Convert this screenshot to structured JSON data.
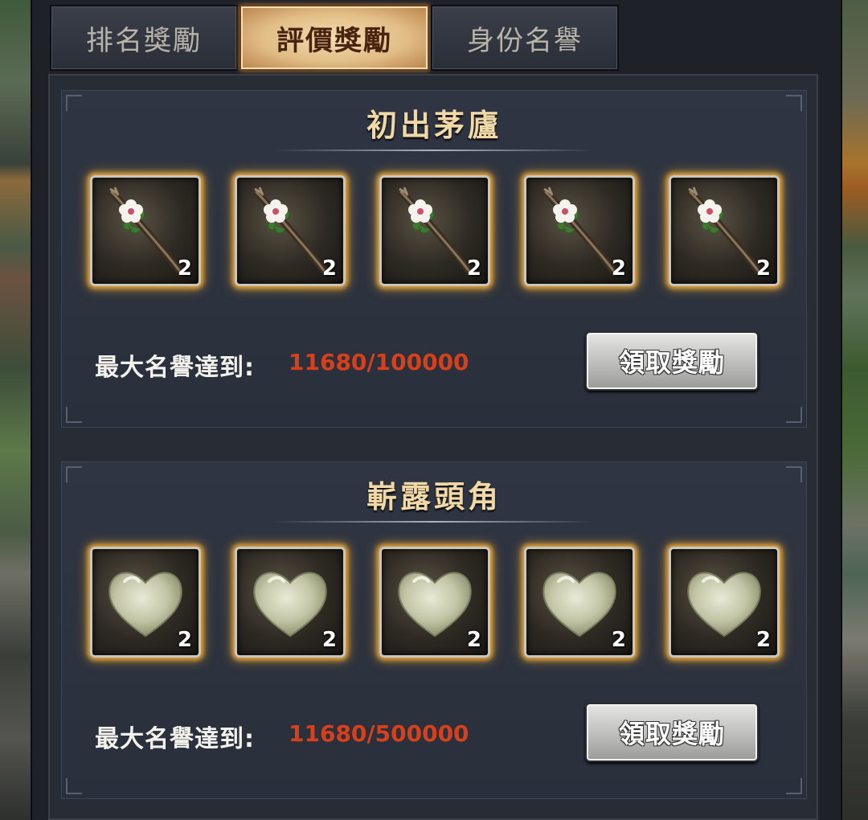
{
  "tabs": [
    {
      "label": "排名獎勵",
      "active": false
    },
    {
      "label": "評價獎勵",
      "active": true
    },
    {
      "label": "身份名譽",
      "active": false
    }
  ],
  "tiers": [
    {
      "title": "初出茅廬",
      "item_icon": "flower-staff-icon",
      "rewards": [
        {
          "icon": "flower-staff-icon",
          "count": "2"
        },
        {
          "icon": "flower-staff-icon",
          "count": "2"
        },
        {
          "icon": "flower-staff-icon",
          "count": "2"
        },
        {
          "icon": "flower-staff-icon",
          "count": "2"
        },
        {
          "icon": "flower-staff-icon",
          "count": "2"
        }
      ],
      "progress_label": "最大名譽達到:",
      "progress_value": "11680/100000",
      "claim_label": "領取獎勵"
    },
    {
      "title": "嶄露頭角",
      "item_icon": "jade-heart-icon",
      "rewards": [
        {
          "icon": "jade-heart-icon",
          "count": "2"
        },
        {
          "icon": "jade-heart-icon",
          "count": "2"
        },
        {
          "icon": "jade-heart-icon",
          "count": "2"
        },
        {
          "icon": "jade-heart-icon",
          "count": "2"
        },
        {
          "icon": "jade-heart-icon",
          "count": "2"
        }
      ],
      "progress_label": "最大名譽達到:",
      "progress_value": "11680/500000",
      "claim_label": "領取獎勵"
    }
  ],
  "colors": {
    "active_tab": "#e2bd86",
    "progress_value": "#d8401c",
    "title": "#f0d9a6",
    "slot_glow": "#e2a23a"
  }
}
